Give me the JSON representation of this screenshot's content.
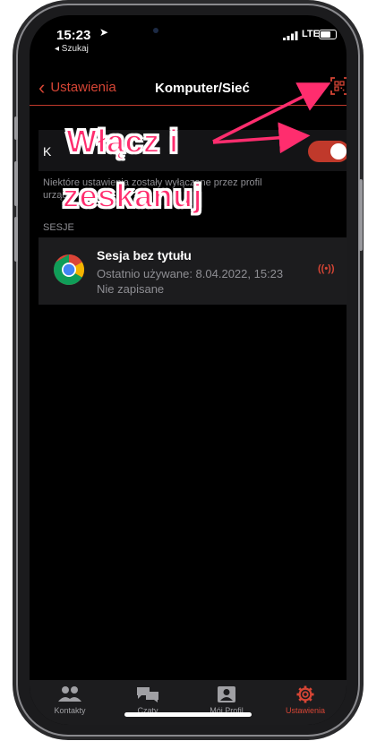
{
  "status_bar": {
    "time": "15:23",
    "location_icon": "location-arrow-icon",
    "back_app": "◂ Szukaj",
    "network": "LTE",
    "battery_level": 0.75
  },
  "nav": {
    "back_label": "Ustawienia",
    "title": "Komputer/Sieć",
    "qr_icon": "qr-scan-icon"
  },
  "toggle_row": {
    "label": "K",
    "enabled": true
  },
  "note": "Niektóre ustawienia zostały wyłączone przez profil urządzenia",
  "section_header": "SESJE",
  "session": {
    "title": "Sesja bez tytułu",
    "last_used": "Ostatnio używane: 8.04.2022, 15:23",
    "status": "Nie zapisane",
    "icon": "chrome-icon",
    "broadcast_icon": "((•))"
  },
  "tabs": [
    {
      "label": "Kontakty",
      "icon": "contacts-icon"
    },
    {
      "label": "Czaty",
      "icon": "chats-icon"
    },
    {
      "label": "Mój Profil",
      "icon": "profile-icon"
    },
    {
      "label": "Ustawienia",
      "icon": "settings-gear-icon"
    }
  ],
  "annotation": {
    "line1": "Włącz i",
    "line2": "zeskanuj",
    "color": "#ff2d6e"
  },
  "colors": {
    "accent": "#d64535",
    "background": "#000000"
  }
}
